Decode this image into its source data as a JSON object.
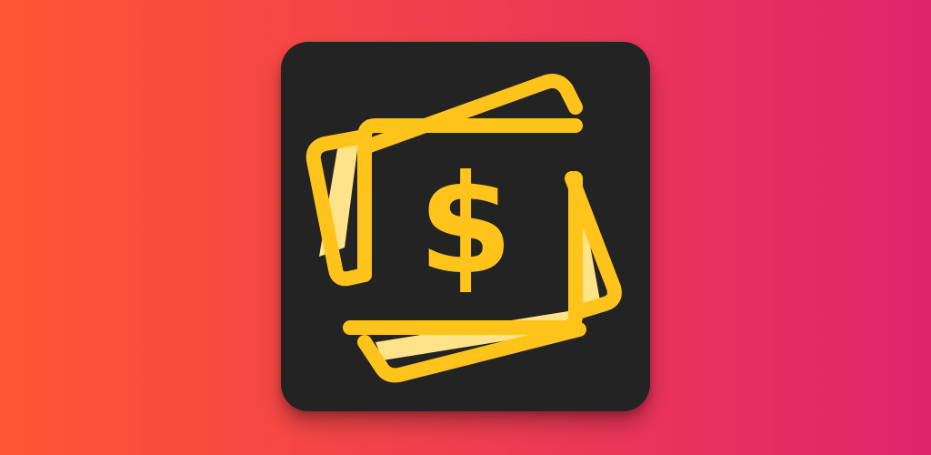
{
  "banner": {
    "gradient_start": "#FF5633",
    "gradient_end": "#E0256C"
  },
  "app_icon": {
    "background_color": "#232323",
    "accent_color": "#FFC41C",
    "accent_light_color": "#FFE38A",
    "icon": "money-bills-icon",
    "symbol": "$"
  }
}
